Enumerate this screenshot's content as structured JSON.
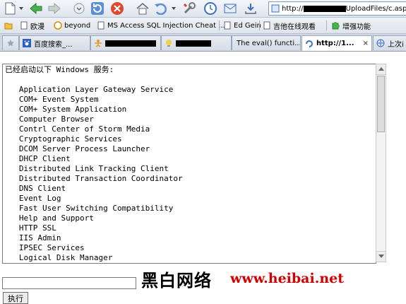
{
  "toolbar": {
    "buttons": [
      "new-page",
      "back",
      "forward",
      "stop",
      "refresh",
      "close",
      "home",
      "undo",
      "tools",
      "history",
      "mail",
      "download"
    ]
  },
  "address": {
    "prefix": "http://",
    "suffix": "UploadFiles/c.asp"
  },
  "bookmarks": [
    {
      "label": "欧漫"
    },
    {
      "label": "beyond"
    },
    {
      "label": "MS Access SQL Injection Cheat ..."
    },
    {
      "label": "Ed Gein"
    },
    {
      "label": "吉他在线观看"
    },
    {
      "label": "增强功能"
    }
  ],
  "tabs": [
    {
      "label": "百度搜索_..."
    },
    {
      "label": ""
    },
    {
      "label": ""
    },
    {
      "label": "The eval() functi..."
    },
    {
      "label": "http://1...",
      "close": "×"
    },
    {
      "label": "上次i"
    }
  ],
  "output": {
    "header": "已经启动以下 Windows 服务:",
    "services": [
      "Application Layer Gateway Service",
      "COM+ Event System",
      "COM+ System Application",
      "Computer Browser",
      "Contrl Center of Storm Media",
      "Cryptographic Services",
      "DCOM Server Process Launcher",
      "DHCP Client",
      "Distributed Link Tracking Client",
      "Distributed Transaction Coordinator",
      "DNS Client",
      "Event Log",
      "Fast User Switching Compatibility",
      "Help and Support",
      "HTTP SSL",
      "IIS Admin",
      "IPSEC Services",
      "Logical Disk Manager"
    ]
  },
  "form": {
    "command_value": "",
    "execute_label": "执行"
  },
  "watermark": {
    "chinese": "黑白网络",
    "url": "www.heibai.net"
  },
  "colors": {
    "watermark_url": "#d40000",
    "chrome": "#dfe5ee"
  }
}
